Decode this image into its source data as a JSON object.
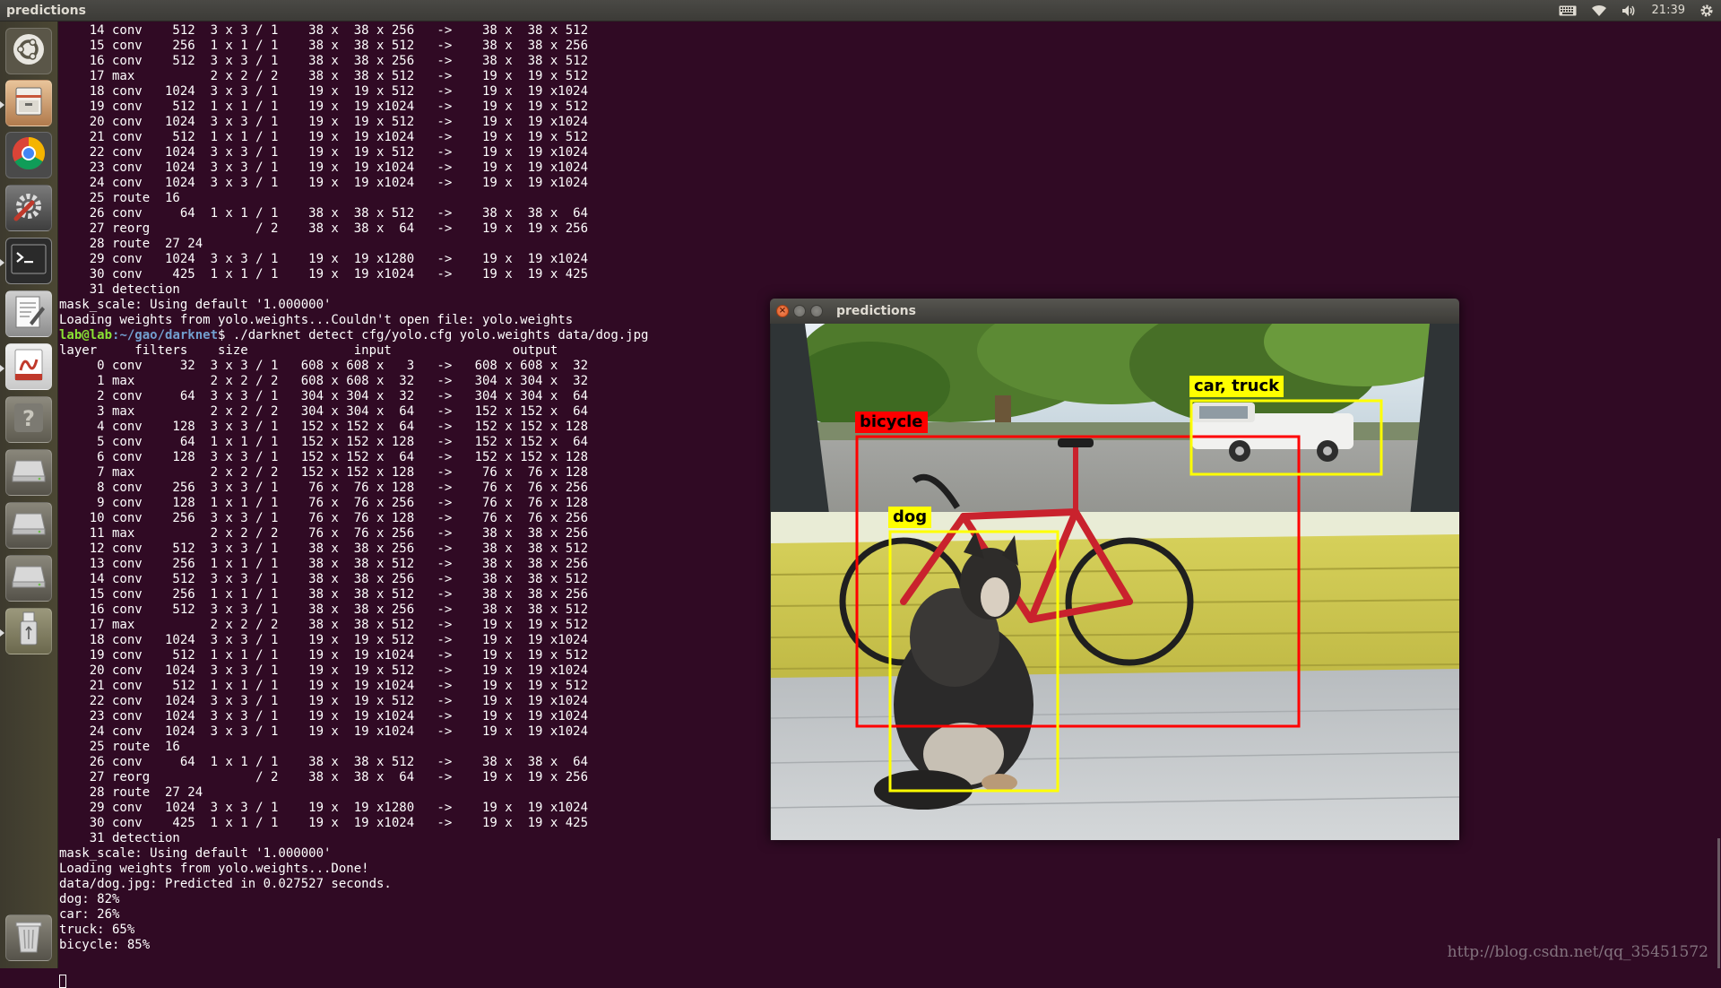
{
  "panel": {
    "title": "predictions",
    "clock": "21:39"
  },
  "launcher": {
    "items": [
      {
        "name": "dash-home",
        "icon": "ubuntu-logo-icon"
      },
      {
        "name": "files",
        "icon": "file-cabinet-icon"
      },
      {
        "name": "chrome",
        "icon": "chrome-icon"
      },
      {
        "name": "system-settings",
        "icon": "settings-wrench-icon"
      },
      {
        "name": "terminal",
        "icon": "terminal-icon"
      },
      {
        "name": "text-editor",
        "icon": "text-editor-icon"
      },
      {
        "name": "document-viewer",
        "icon": "pdf-viewer-icon"
      },
      {
        "name": "help",
        "icon": "help-icon"
      },
      {
        "name": "drive-1",
        "icon": "drive-icon"
      },
      {
        "name": "drive-2",
        "icon": "drive-icon"
      },
      {
        "name": "drive-3",
        "icon": "drive-icon"
      },
      {
        "name": "usb-drive",
        "icon": "usb-icon"
      },
      {
        "name": "trash",
        "icon": "trash-icon"
      }
    ]
  },
  "terminal": {
    "before_prompt": "    14 conv    512  3 x 3 / 1    38 x  38 x 256   ->    38 x  38 x 512\n    15 conv    256  1 x 1 / 1    38 x  38 x 512   ->    38 x  38 x 256\n    16 conv    512  3 x 3 / 1    38 x  38 x 256   ->    38 x  38 x 512\n    17 max          2 x 2 / 2    38 x  38 x 512   ->    19 x  19 x 512\n    18 conv   1024  3 x 3 / 1    19 x  19 x 512   ->    19 x  19 x1024\n    19 conv    512  1 x 1 / 1    19 x  19 x1024   ->    19 x  19 x 512\n    20 conv   1024  3 x 3 / 1    19 x  19 x 512   ->    19 x  19 x1024\n    21 conv    512  1 x 1 / 1    19 x  19 x1024   ->    19 x  19 x 512\n    22 conv   1024  3 x 3 / 1    19 x  19 x 512   ->    19 x  19 x1024\n    23 conv   1024  3 x 3 / 1    19 x  19 x1024   ->    19 x  19 x1024\n    24 conv   1024  3 x 3 / 1    19 x  19 x1024   ->    19 x  19 x1024\n    25 route  16\n    26 conv     64  1 x 1 / 1    38 x  38 x 512   ->    38 x  38 x  64\n    27 reorg              / 2    38 x  38 x  64   ->    19 x  19 x 256\n    28 route  27 24\n    29 conv   1024  3 x 3 / 1    19 x  19 x1280   ->    19 x  19 x1024\n    30 conv    425  1 x 1 / 1    19 x  19 x1024   ->    19 x  19 x 425\n    31 detection\nmask_scale: Using default '1.000000'\nLoading weights from yolo.weights...Couldn't open file: yolo.weights\n",
    "prompt_user": "lab@lab",
    "prompt_path": ":~/gao/darknet",
    "command": "$ ./darknet detect cfg/yolo.cfg yolo.weights data/dog.jpg",
    "after_prompt": "\nlayer     filters    size              input                output\n     0 conv     32  3 x 3 / 1   608 x 608 x   3   ->   608 x 608 x  32\n     1 max          2 x 2 / 2   608 x 608 x  32   ->   304 x 304 x  32\n     2 conv     64  3 x 3 / 1   304 x 304 x  32   ->   304 x 304 x  64\n     3 max          2 x 2 / 2   304 x 304 x  64   ->   152 x 152 x  64\n     4 conv    128  3 x 3 / 1   152 x 152 x  64   ->   152 x 152 x 128\n     5 conv     64  1 x 1 / 1   152 x 152 x 128   ->   152 x 152 x  64\n     6 conv    128  3 x 3 / 1   152 x 152 x  64   ->   152 x 152 x 128\n     7 max          2 x 2 / 2   152 x 152 x 128   ->    76 x  76 x 128\n     8 conv    256  3 x 3 / 1    76 x  76 x 128   ->    76 x  76 x 256\n     9 conv    128  1 x 1 / 1    76 x  76 x 256   ->    76 x  76 x 128\n    10 conv    256  3 x 3 / 1    76 x  76 x 128   ->    76 x  76 x 256\n    11 max          2 x 2 / 2    76 x  76 x 256   ->    38 x  38 x 256\n    12 conv    512  3 x 3 / 1    38 x  38 x 256   ->    38 x  38 x 512\n    13 conv    256  1 x 1 / 1    38 x  38 x 512   ->    38 x  38 x 256\n    14 conv    512  3 x 3 / 1    38 x  38 x 256   ->    38 x  38 x 512\n    15 conv    256  1 x 1 / 1    38 x  38 x 512   ->    38 x  38 x 256\n    16 conv    512  3 x 3 / 1    38 x  38 x 256   ->    38 x  38 x 512\n    17 max          2 x 2 / 2    38 x  38 x 512   ->    19 x  19 x 512\n    18 conv   1024  3 x 3 / 1    19 x  19 x 512   ->    19 x  19 x1024\n    19 conv    512  1 x 1 / 1    19 x  19 x1024   ->    19 x  19 x 512\n    20 conv   1024  3 x 3 / 1    19 x  19 x 512   ->    19 x  19 x1024\n    21 conv    512  1 x 1 / 1    19 x  19 x1024   ->    19 x  19 x 512\n    22 conv   1024  3 x 3 / 1    19 x  19 x 512   ->    19 x  19 x1024\n    23 conv   1024  3 x 3 / 1    19 x  19 x1024   ->    19 x  19 x1024\n    24 conv   1024  3 x 3 / 1    19 x  19 x1024   ->    19 x  19 x1024\n    25 route  16\n    26 conv     64  1 x 1 / 1    38 x  38 x 512   ->    38 x  38 x  64\n    27 reorg              / 2    38 x  38 x  64   ->    19 x  19 x 256\n    28 route  27 24\n    29 conv   1024  3 x 3 / 1    19 x  19 x1280   ->    19 x  19 x1024\n    30 conv    425  1 x 1 / 1    19 x  19 x1024   ->    19 x  19 x 425\n    31 detection\nmask_scale: Using default '1.000000'\nLoading weights from yolo.weights...Done!\ndata/dog.jpg: Predicted in 0.027527 seconds.\ndog: 82%\ncar: 26%\ntruck: 65%\nbicycle: 85%"
  },
  "predictions_window": {
    "title": "predictions",
    "detections": [
      {
        "label": "bicycle",
        "color": "#ff0000"
      },
      {
        "label": "car, truck",
        "color": "#ffff00"
      },
      {
        "label": "dog",
        "color": "#ffff00"
      }
    ]
  },
  "watermark": "http://blog.csdn.net/qq_35451572"
}
